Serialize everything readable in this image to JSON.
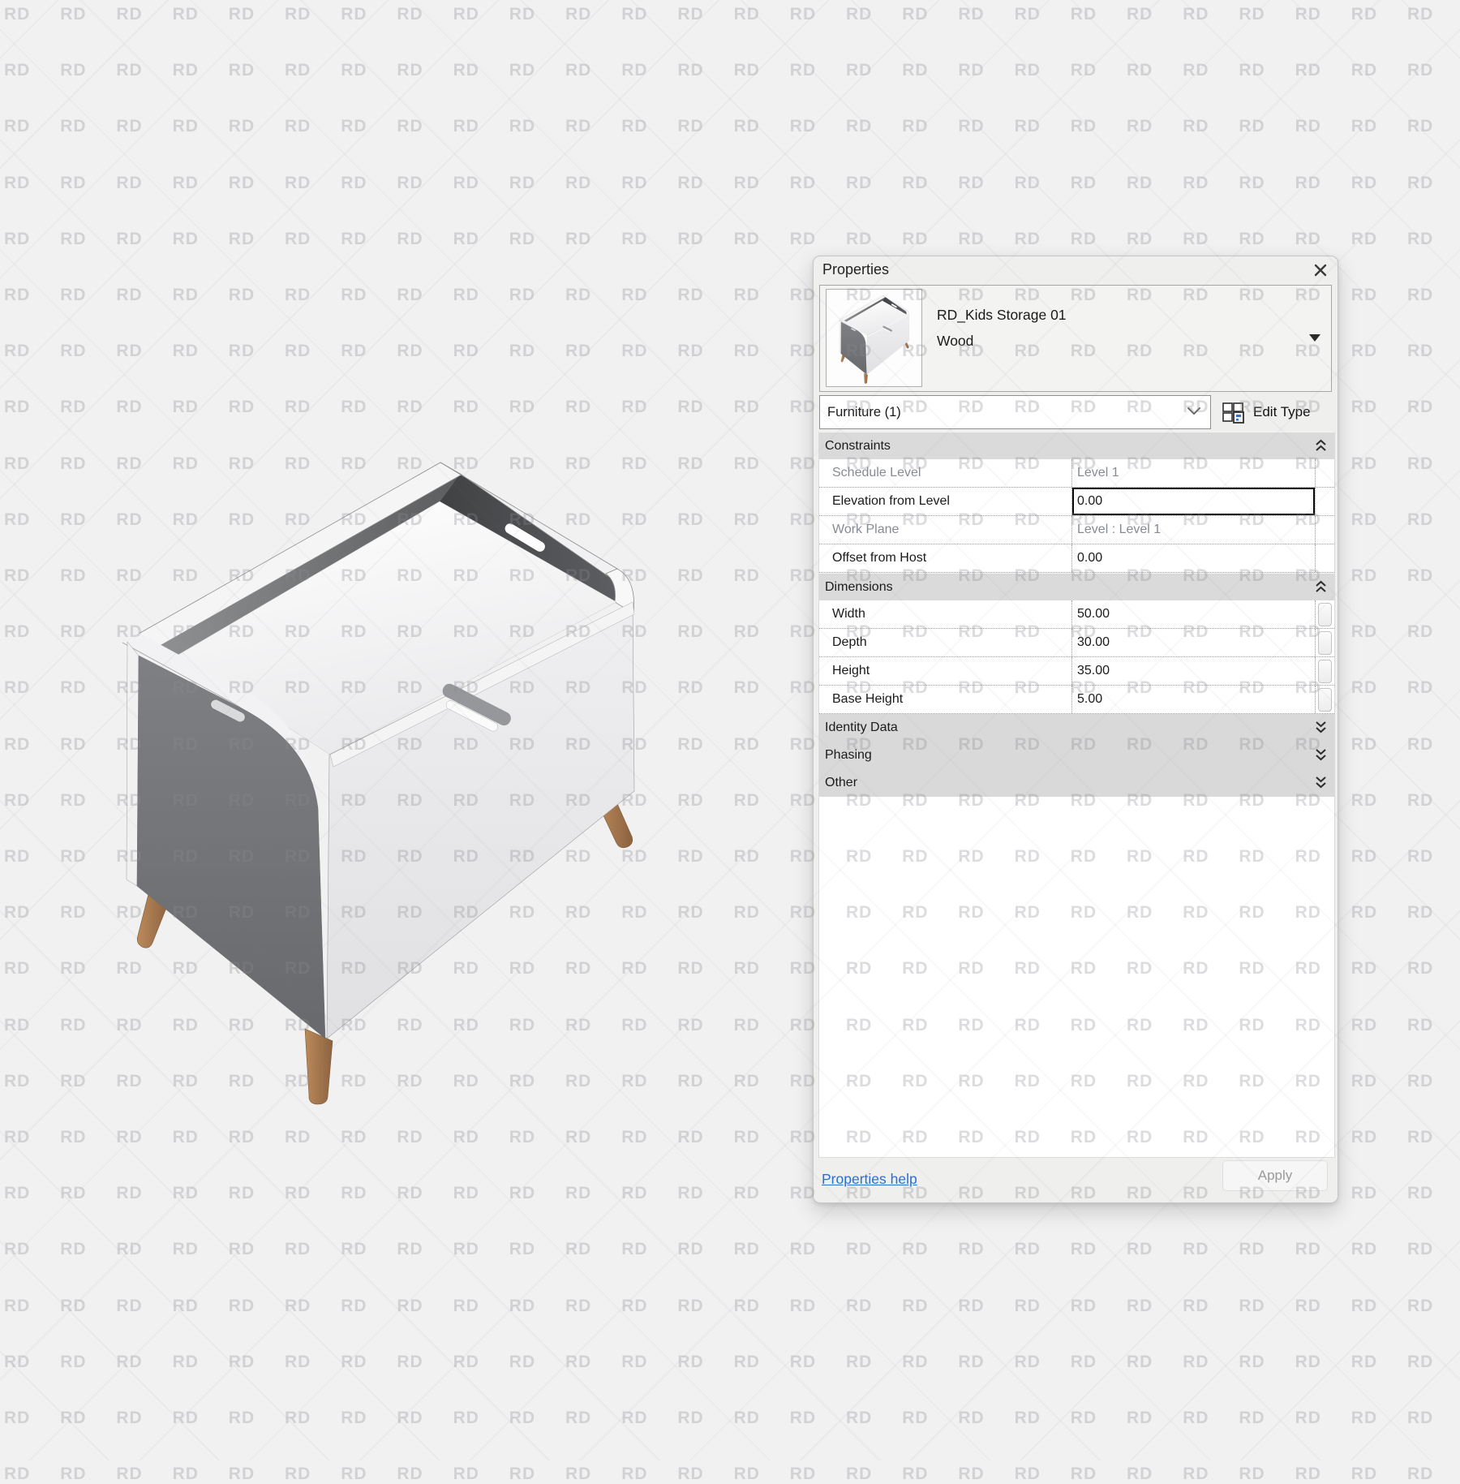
{
  "window": {
    "title": "Properties"
  },
  "type_selector": {
    "family_name": "RD_Kids Storage 01",
    "type_name": "Wood"
  },
  "selector_bar": {
    "category": "Furniture (1)",
    "edit_type_label": "Edit Type"
  },
  "grid": {
    "constraints": {
      "title": "Constraints",
      "rows": [
        {
          "label": "Schedule Level",
          "value": "Level 1"
        },
        {
          "label": "Elevation from Level",
          "value": "0.00"
        },
        {
          "label": "Work Plane",
          "value": "Level : Level 1"
        },
        {
          "label": "Offset from Host",
          "value": "0.00"
        }
      ]
    },
    "dimensions": {
      "title": "Dimensions",
      "rows": [
        {
          "label": "Width",
          "value": "50.00"
        },
        {
          "label": "Depth",
          "value": "30.00"
        },
        {
          "label": "Height",
          "value": "35.00"
        },
        {
          "label": "Base Height",
          "value": "5.00"
        }
      ]
    },
    "collapsed_sections": [
      {
        "title": "Identity Data"
      },
      {
        "title": "Phasing"
      },
      {
        "title": "Other"
      }
    ]
  },
  "footer": {
    "help_link": "Properties help",
    "apply_label": "Apply"
  },
  "watermark": {
    "text": "RD"
  },
  "colors": {
    "background": "#f1f1f2",
    "panel": "#efefee",
    "section_header": "#dadada",
    "link_blue": "#2a6fd6",
    "wood_leg": "#a97a4e",
    "side_gray": "#73757 8"
  }
}
